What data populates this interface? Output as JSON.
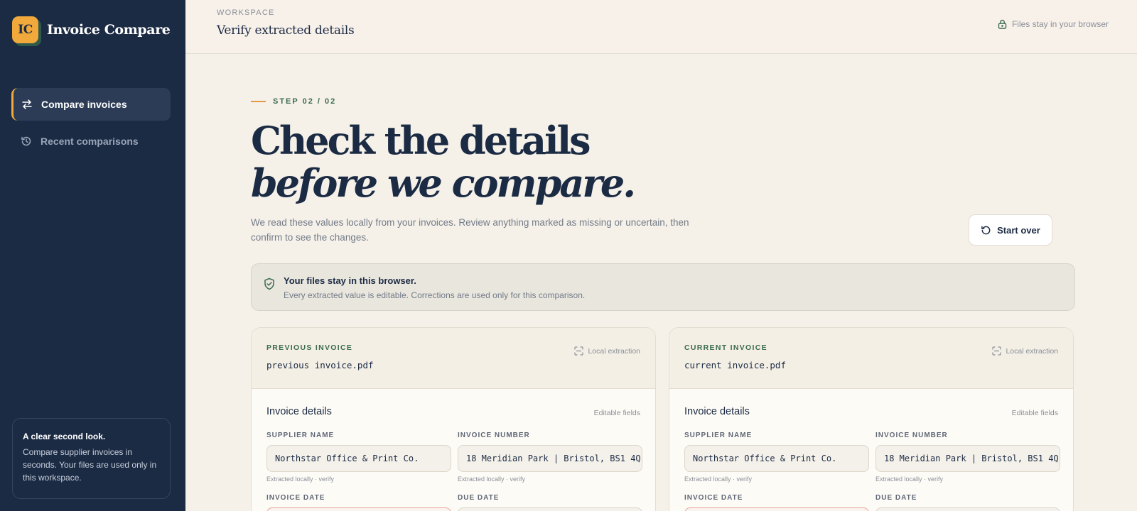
{
  "app": {
    "logo_text": "IC",
    "name": "Invoice Compare"
  },
  "sidebar": {
    "items": [
      {
        "label": "Compare invoices"
      },
      {
        "label": "Recent comparisons"
      }
    ],
    "card": {
      "title": "A clear second look.",
      "text": "Compare supplier invoices in seconds. Your files are used only in this workspace."
    }
  },
  "topbar": {
    "eyebrow": "WORKSPACE",
    "title": "Verify extracted details",
    "privacy": "Files stay in your browser"
  },
  "main": {
    "step": "STEP 02 / 02",
    "headline_line1": "Check the details",
    "headline_line2": "before we compare.",
    "lede": "We read these values locally from your invoices. Review anything marked as missing or uncertain, then confirm to see the changes.",
    "start_over": "Start over",
    "notice": {
      "title": "Your files stay in this browser.",
      "text": "Every extracted value is editable. Corrections are used only for this comparison."
    }
  },
  "cards": [
    {
      "label": "PREVIOUS INVOICE",
      "file": "previous invoice.pdf",
      "badge": "Local extraction",
      "section_title": "Invoice details",
      "section_aside": "Editable fields",
      "fields": [
        {
          "label": "SUPPLIER NAME",
          "value": "Northstar Office & Print Co.",
          "hint": "Extracted locally · verify"
        },
        {
          "label": "INVOICE NUMBER",
          "value": "18 Meridian Park | Bristol, BS1 4Q",
          "hint": "Extracted locally · verify"
        },
        {
          "label": "INVOICE DATE",
          "value": ""
        },
        {
          "label": "DUE DATE",
          "value": ""
        }
      ]
    },
    {
      "label": "CURRENT INVOICE",
      "file": "current invoice.pdf",
      "badge": "Local extraction",
      "section_title": "Invoice details",
      "section_aside": "Editable fields",
      "fields": [
        {
          "label": "SUPPLIER NAME",
          "value": "Northstar Office & Print Co.",
          "hint": "Extracted locally · verify"
        },
        {
          "label": "INVOICE NUMBER",
          "value": "18 Meridian Park | Bristol, BS1 4Q",
          "hint": "Extracted locally · verify"
        },
        {
          "label": "INVOICE DATE",
          "value": ""
        },
        {
          "label": "DUE DATE",
          "value": ""
        }
      ]
    }
  ],
  "colors": {
    "sidebar_bg": "#1c2b44",
    "accent": "#f2a93b",
    "green": "#3c6b52",
    "error_border": "#e8a59c"
  },
  "icons": [
    "swap-arrows-icon",
    "history-icon",
    "lock-icon",
    "refresh-icon",
    "shield-check-icon",
    "scan-icon"
  ]
}
